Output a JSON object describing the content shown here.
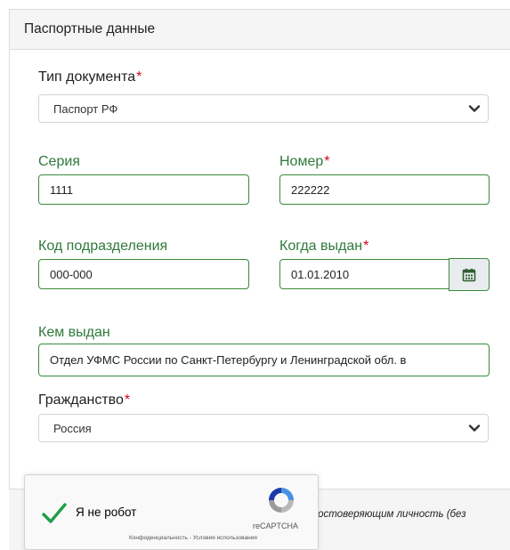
{
  "panel": {
    "title": "Паспортные данные"
  },
  "fields": {
    "doc_type": {
      "label": "Тип документа",
      "required_mark": "*",
      "value": "Паспорт РФ"
    },
    "series": {
      "label": "Серия",
      "value": "1111"
    },
    "number": {
      "label": "Номер",
      "required_mark": "*",
      "value": "222222"
    },
    "division_code": {
      "label": "Код подразделения",
      "value": "000-000"
    },
    "issue_date": {
      "label": "Когда выдан",
      "required_mark": "*",
      "value": "01.01.2010"
    },
    "issued_by": {
      "label": "Кем выдан",
      "value": "Отдел УФМС России по Санкт-Петербургу и Ленинградской обл. в"
    },
    "citizenship": {
      "label": "Гражданство",
      "required_mark": "*",
      "value": "Россия"
    }
  },
  "footer": {
    "text": "удостоверяющим личность (без"
  },
  "recaptcha": {
    "label": "Я не робот",
    "brand": "reCAPTCHA",
    "terms": "Конфиденциальность - Условия использования"
  },
  "colors": {
    "label_green": "#2f7a3b",
    "required_red": "#d0021b",
    "input_border_green": "#3a8a3a"
  }
}
